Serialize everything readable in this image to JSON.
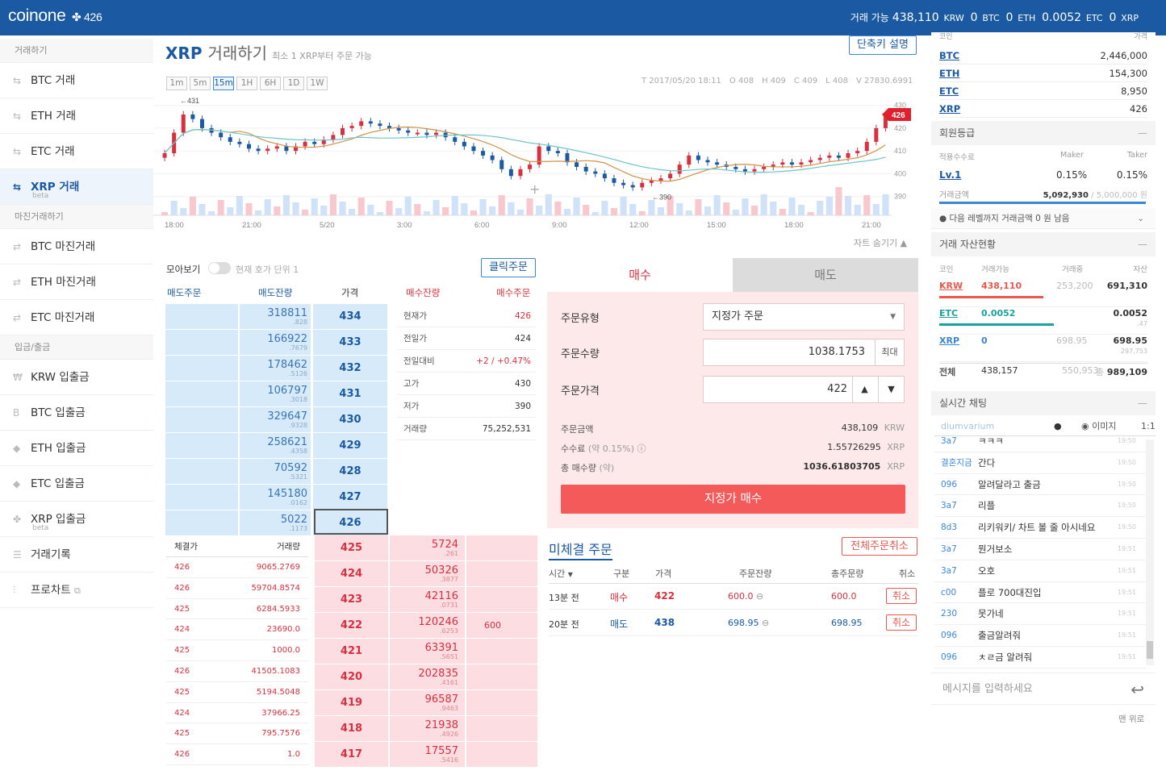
{
  "header": {
    "logo": "coinone",
    "logo_sub": "426",
    "avail_label": "거래 가능",
    "krw": "438,110",
    "krw_unit": "KRW",
    "btc": "0",
    "btc_unit": "BTC",
    "eth": "0",
    "eth_unit": "ETH",
    "etc": "0.0052",
    "etc_unit": "ETC",
    "xrp": "0",
    "xrp_unit": "XRP"
  },
  "sidebar": {
    "sec1": "거래하기",
    "sec2": "마진거래하기",
    "sec3": "입금/출금",
    "items": [
      {
        "label": "BTC 거래"
      },
      {
        "label": "ETH 거래"
      },
      {
        "label": "ETC 거래"
      },
      {
        "label": "XRP 거래",
        "beta": "beta"
      },
      {
        "label": "BTC 마진거래"
      },
      {
        "label": "ETH 마진거래"
      },
      {
        "label": "ETC 마진거래"
      },
      {
        "label": "KRW 입출금"
      },
      {
        "label": "BTC 입출금"
      },
      {
        "label": "ETH 입출금"
      },
      {
        "label": "ETC 입출금"
      },
      {
        "label": "XRP 입출금",
        "beta": "beta"
      },
      {
        "label": "거래기록"
      },
      {
        "label": "프로차트"
      }
    ]
  },
  "title": {
    "coin": "XRP",
    "text": "거래하기",
    "sub": "최소 1 XRP부터 주문 가능",
    "shortcut": "단축키 설명"
  },
  "timeframes": [
    "1m",
    "5m",
    "15m",
    "1H",
    "6H",
    "1D",
    "1W"
  ],
  "ohlc": {
    "t": "T 2017/05/20 18:11",
    "o": "O 408",
    "h": "H 409",
    "c": "C 409",
    "l": "L 408",
    "v": "V 27830.6991"
  },
  "chart_data": {
    "type": "candlestick",
    "x_labels": [
      "18:00",
      "21:00",
      "5/20",
      "3:00",
      "6:00",
      "9:00",
      "12:00",
      "15:00",
      "18:00",
      "21:00"
    ],
    "y_ticks": [
      390,
      400,
      410,
      420,
      430
    ],
    "ylim": [
      386,
      432
    ],
    "current": 426,
    "high_label": "431",
    "low_label": "390",
    "closes": [
      409,
      418,
      426,
      424,
      420,
      418,
      416,
      414,
      413,
      411,
      410,
      411,
      412,
      410,
      412,
      414,
      413,
      415,
      417,
      420,
      421,
      423,
      422,
      421,
      420,
      419,
      418,
      418,
      417,
      418,
      416,
      414,
      412,
      410,
      408,
      406,
      402,
      399,
      402,
      404,
      412,
      410,
      409,
      405,
      403,
      401,
      400,
      398,
      396,
      395,
      394,
      396,
      397,
      398,
      400,
      404,
      408,
      406,
      405,
      404,
      403,
      402,
      401,
      402,
      403,
      404,
      405,
      404,
      405,
      406,
      407,
      408,
      407,
      409,
      410,
      414,
      420,
      426
    ]
  },
  "hide_chart": "자트 숨기기",
  "orderbook": {
    "toggle_label": "모아보기",
    "hint": "현재 호가 단위 1",
    "click_order": "클릭주문",
    "cols": {
      "ask_order": "매도주문",
      "ask_qty": "매도잔량",
      "price": "가격",
      "bid_qty": "매수잔량",
      "bid_order": "매수주문"
    },
    "asks": [
      {
        "qty": "318811",
        "dec": ".828",
        "price": "434"
      },
      {
        "qty": "166922",
        "dec": ".7679",
        "price": "433"
      },
      {
        "qty": "178462",
        "dec": ".5126",
        "price": "432"
      },
      {
        "qty": "106797",
        "dec": ".3018",
        "price": "431"
      },
      {
        "qty": "329647",
        "dec": ".9328",
        "price": "430"
      },
      {
        "qty": "258621",
        "dec": ".4358",
        "price": "429"
      },
      {
        "qty": "70592",
        "dec": ".5321",
        "price": "428"
      },
      {
        "qty": "145180",
        "dec": ".0162",
        "price": "427"
      },
      {
        "qty": "5022",
        "dec": ".1173",
        "price": "426"
      }
    ],
    "bids": [
      {
        "price": "425",
        "qty": "5724",
        "dec": ".261",
        "order": ""
      },
      {
        "price": "424",
        "qty": "50326",
        "dec": ".3877",
        "order": ""
      },
      {
        "price": "423",
        "qty": "42116",
        "dec": ".0731",
        "order": ""
      },
      {
        "price": "422",
        "qty": "120246",
        "dec": ".6253",
        "order": "600"
      },
      {
        "price": "421",
        "qty": "63391",
        "dec": ".5651",
        "order": ""
      },
      {
        "price": "420",
        "qty": "202835",
        "dec": ".4161",
        "order": ""
      },
      {
        "price": "419",
        "qty": "96587",
        "dec": ".9463",
        "order": ""
      },
      {
        "price": "418",
        "qty": "21938",
        "dec": ".4926",
        "order": ""
      },
      {
        "price": "417",
        "qty": "17557",
        "dec": ".5416",
        "order": ""
      }
    ],
    "info": [
      {
        "label": "현재가",
        "value": "426"
      },
      {
        "label": "전일가",
        "value": "424"
      },
      {
        "label": "전일대비",
        "value": "+2 / +0.47%"
      },
      {
        "label": "고가",
        "value": "430"
      },
      {
        "label": "저가",
        "value": "390"
      },
      {
        "label": "거래량",
        "value": "75,252,531"
      }
    ],
    "trades_head": {
      "price": "체결가",
      "qty": "거래량"
    },
    "trades": [
      {
        "p": "426",
        "q": "9065.2769"
      },
      {
        "p": "426",
        "q": "59704.8574"
      },
      {
        "p": "425",
        "q": "6284.5933"
      },
      {
        "p": "424",
        "q": "23690.0"
      },
      {
        "p": "425",
        "q": "1000.0"
      },
      {
        "p": "426",
        "q": "41505.1083"
      },
      {
        "p": "425",
        "q": "5194.5048"
      },
      {
        "p": "424",
        "q": "37966.25"
      },
      {
        "p": "425",
        "q": "795.7576"
      },
      {
        "p": "426",
        "q": "1.0"
      }
    ]
  },
  "orderform": {
    "buy_tab": "매수",
    "sell_tab": "매도",
    "type_label": "주문유형",
    "type_value": "지정가 주문",
    "qty_label": "주문수량",
    "qty_value": "1038.1753",
    "max": "최대",
    "price_label": "주문가격",
    "price_value": "422",
    "total_label": "주문금액",
    "total_value": "438,109",
    "total_unit": "KRW",
    "fee_label": "수수료",
    "fee_pct": "(약 0.15%)",
    "fee_value": "1.55726295",
    "fee_unit": "XRP",
    "buyqty_label": "총 매수량",
    "buyqty_pct": "(약)",
    "buyqty_value": "1036.61803705",
    "buyqty_unit": "XRP",
    "submit": "지정가 매수"
  },
  "open_orders": {
    "title": "미체결 주문",
    "cancel_all": "전체주문취소",
    "cols": {
      "time": "시간",
      "type": "구분",
      "price": "가격",
      "remain": "주문잔량",
      "total": "총주문량",
      "cancel": "취소"
    },
    "rows": [
      {
        "time": "13분 전",
        "type": "매수",
        "price": "422",
        "remain": "600.0",
        "total": "600.0",
        "cancel": "취소"
      },
      {
        "time": "20분 전",
        "type": "매도",
        "price": "438",
        "remain": "698.95",
        "total": "698.95",
        "cancel": "취소"
      }
    ]
  },
  "right": {
    "coin_col": "코인",
    "price_col": "가격",
    "prices": [
      {
        "c": "BTC",
        "v": "2,446,000"
      },
      {
        "c": "ETH",
        "v": "154,300"
      },
      {
        "c": "ETC",
        "v": "8,950"
      },
      {
        "c": "XRP",
        "v": "426"
      }
    ],
    "member_title": "회원등급",
    "fee_head": {
      "label": "적용수수료",
      "maker": "Maker",
      "taker": "Taker"
    },
    "level": {
      "lv": "Lv.1",
      "maker": "0.15%",
      "taker": "0.15%"
    },
    "volume_label": "거래금액",
    "volume_value": "5,092,930",
    "volume_limit": "5,000,000 원",
    "next_level": "다음 레벨까지 거래금액 0 원 남음",
    "asset_title": "거래 자산현황",
    "asset_head": {
      "coin": "코인",
      "avail": "거래가능",
      "inuse": "거래중",
      "total": "자산"
    },
    "assets": [
      {
        "c": "KRW",
        "a": "438,110",
        "u": "253,200",
        "t": "691,310",
        "d": ""
      },
      {
        "c": "ETC",
        "a": "0.0052",
        "u": "",
        "t": "0.0052",
        "d": ".47"
      },
      {
        "c": "XRP",
        "a": "0",
        "u": "698.95",
        "t": "698.95",
        "d": "297,753"
      }
    ],
    "asset_total": {
      "c": "전체",
      "a": "438,157",
      "u": "550,953",
      "t": "989,109",
      "prefix": "총"
    },
    "chat_title": "실시간 채팅",
    "chat_user": "diumvarium",
    "chat_image": "이미지",
    "chat_mode": "1:1",
    "chats": [
      {
        "u": "3a7",
        "m": "ㅋㅋㅋ",
        "t": "19:50"
      },
      {
        "u": "결혼지금",
        "m": "간다",
        "t": "19:50"
      },
      {
        "u": "096",
        "m": "알려달라고 출금",
        "t": "19:50"
      },
      {
        "u": "3a7",
        "m": "리플",
        "t": "19:50"
      },
      {
        "u": "8d3",
        "m": "리키워키/ 차트 볼 줄 아시네요",
        "t": "19:50"
      },
      {
        "u": "3a7",
        "m": "뭔거보소",
        "t": "19:51"
      },
      {
        "u": "3a7",
        "m": "오호",
        "t": "19:51"
      },
      {
        "u": "c00",
        "m": "플로 700대진입",
        "t": "19:51"
      },
      {
        "u": "230",
        "m": "못가네",
        "t": "19:51"
      },
      {
        "u": "096",
        "m": "출금알려줘",
        "t": "19:51"
      },
      {
        "u": "096",
        "m": "ㅊㄹ금 알려줘",
        "t": "19:51"
      }
    ],
    "chat_placeholder": "메시지를 입력하세요",
    "to_top": "맨 위로"
  }
}
